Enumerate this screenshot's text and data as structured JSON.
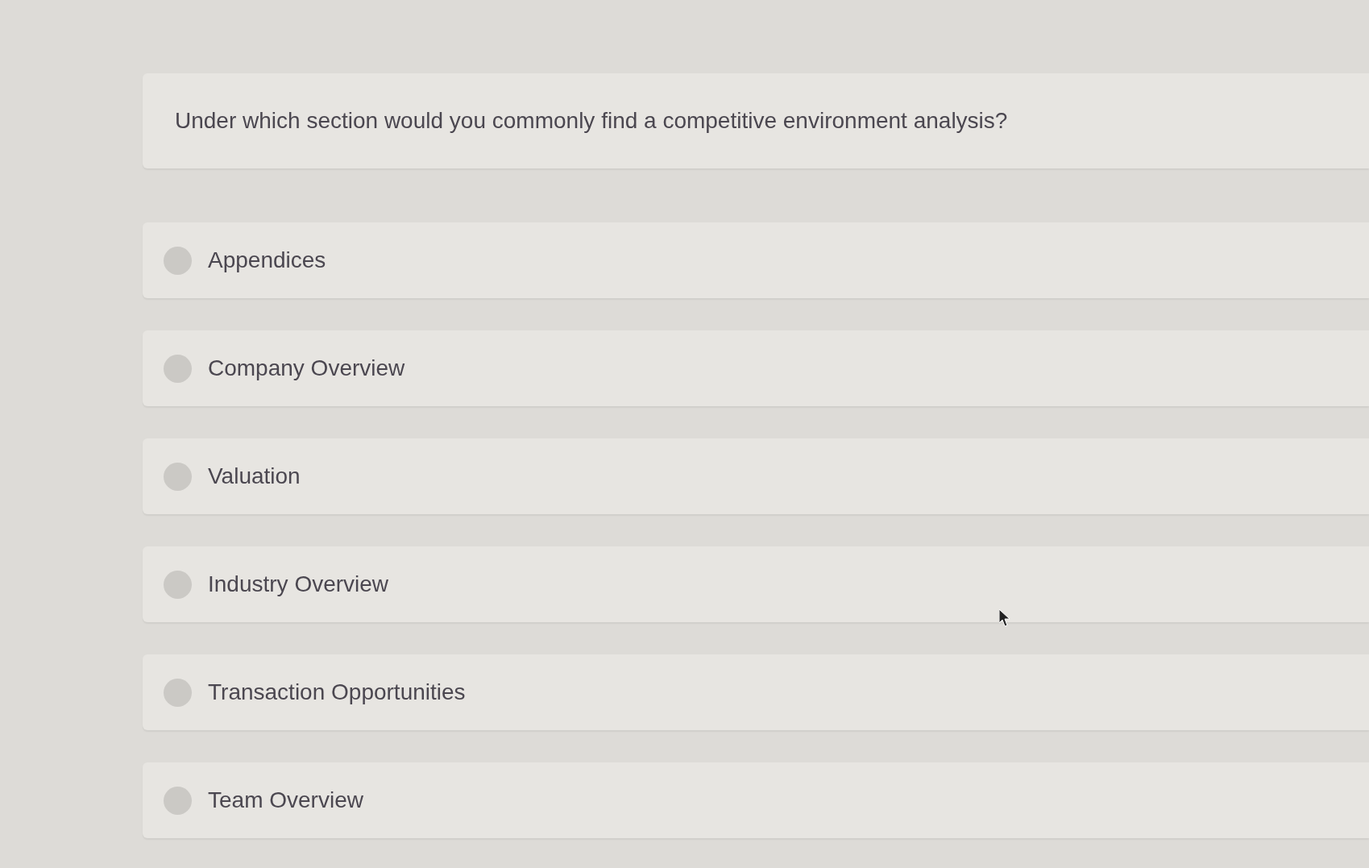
{
  "question": {
    "text": "Under which section would you commonly find a competitive environment analysis?"
  },
  "options": [
    {
      "label": "Appendices",
      "selected": false
    },
    {
      "label": "Company Overview",
      "selected": false
    },
    {
      "label": "Valuation",
      "selected": false
    },
    {
      "label": "Industry Overview",
      "selected": false
    },
    {
      "label": "Transaction Opportunities",
      "selected": false
    },
    {
      "label": "Team Overview",
      "selected": false
    }
  ]
}
